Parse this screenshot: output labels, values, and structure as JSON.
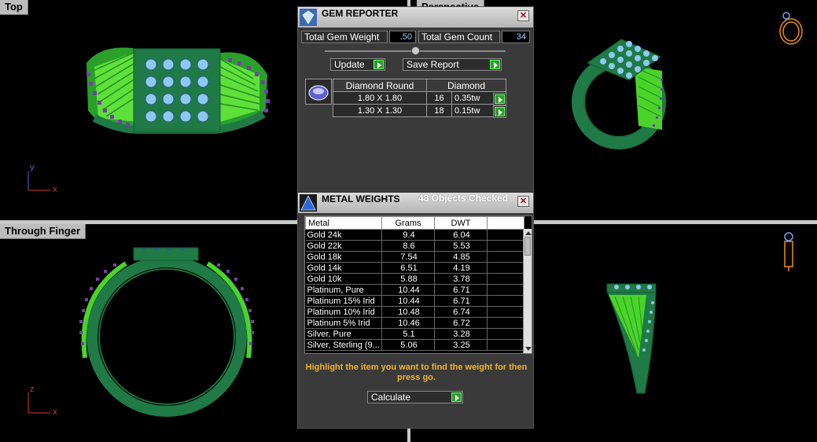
{
  "viewports": {
    "top": "Top",
    "perspective": "Perspective",
    "through_finger": "Through Finger",
    "top_axes": {
      "x": "x",
      "y": "y"
    },
    "finger_axes": {
      "x": "x",
      "y": "z"
    }
  },
  "gem_reporter": {
    "title": "GEM REPORTER",
    "close_label": "✕",
    "total_gem_weight_label": "Total Gem Weight",
    "total_gem_weight_value": ".50",
    "total_gem_count_label": "Total Gem Count",
    "total_gem_count_value": "34",
    "update_label": "Update",
    "save_report_label": "Save Report",
    "table": {
      "headers": [
        "Diamond Round",
        "Diamond"
      ],
      "rows": [
        {
          "size": "1.80 X 1.80",
          "count": "16",
          "weight": "0.35tw"
        },
        {
          "size": "1.30 X 1.30",
          "count": "18",
          "weight": "0.15tw"
        }
      ]
    }
  },
  "metal_weights": {
    "title": "METAL WEIGHTS",
    "objects_checked": "48 Objects Checked",
    "close_label": "✕",
    "headers": [
      "Metal",
      "Grams",
      "DWT"
    ],
    "rows": [
      {
        "metal": "Gold 24k",
        "grams": "9.4",
        "dwt": "6.04"
      },
      {
        "metal": "Gold 22k",
        "grams": "8.6",
        "dwt": "5.53"
      },
      {
        "metal": "Gold 18k",
        "grams": "7.54",
        "dwt": "4.85"
      },
      {
        "metal": "Gold 14k",
        "grams": "6.51",
        "dwt": "4.19"
      },
      {
        "metal": "Gold 10k",
        "grams": "5.88",
        "dwt": "3.78"
      },
      {
        "metal": "Platinum, Pure",
        "grams": "10.44",
        "dwt": "6.71"
      },
      {
        "metal": "Platinum 15% Irid",
        "grams": "10.44",
        "dwt": "6.71"
      },
      {
        "metal": "Platinum 10% Irid",
        "grams": "10.48",
        "dwt": "6.74"
      },
      {
        "metal": "Platinum 5% Irid",
        "grams": "10.46",
        "dwt": "6.72"
      },
      {
        "metal": "Silver, Pure",
        "grams": "5.1",
        "dwt": "3.28"
      },
      {
        "metal": "Silver, Sterling (9...",
        "grams": "5.06",
        "dwt": "3.25"
      }
    ],
    "instruction": "Highlight the item you want to find the weight for then press go.",
    "calculate_label": "Calculate"
  },
  "colors": {
    "ring_green": "#1f7a45",
    "ring_light_green": "#4ad42a",
    "gem_blue": "#8cc8f0",
    "pave_purple": "#7a3ab0",
    "accent_orange": "#f0b229"
  }
}
